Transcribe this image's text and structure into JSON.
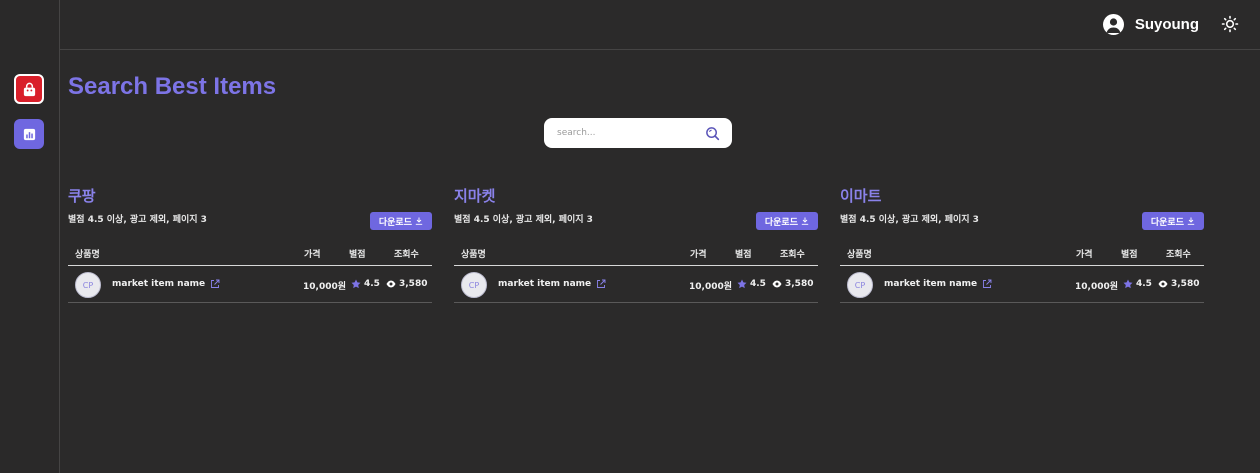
{
  "user": {
    "name": "Suyoung"
  },
  "page": {
    "title": "Search Best Items"
  },
  "search": {
    "placeholder": "search..."
  },
  "table_headers": {
    "product": "상품명",
    "price": "가격",
    "rating": "별점",
    "views": "조회수"
  },
  "panels": [
    {
      "title": "쿠팡",
      "subtitle": "별점 4.5 이상, 광고 제외, 페이지 3",
      "download_label": "다운로드",
      "rows": [
        {
          "avatar": "CP",
          "name": "market item name",
          "price": "10,000원",
          "rating": "4.5",
          "views": "3,580"
        }
      ]
    },
    {
      "title": "지마켓",
      "subtitle": "별점 4.5 이상, 광고 제외, 페이지 3",
      "download_label": "다운로드",
      "rows": [
        {
          "avatar": "CP",
          "name": "market item name",
          "price": "10,000원",
          "rating": "4.5",
          "views": "3,580"
        }
      ]
    },
    {
      "title": "이마트",
      "subtitle": "별점 4.5 이상, 광고 제외, 페이지 3",
      "download_label": "다운로드",
      "rows": [
        {
          "avatar": "CP",
          "name": "market item name",
          "price": "10,000원",
          "rating": "4.5",
          "views": "3,580"
        }
      ]
    }
  ],
  "icons": {
    "sidebar": [
      "shopping-bag-icon",
      "bar-chart-icon"
    ],
    "header": [
      "user-avatar-icon",
      "sun-icon"
    ],
    "search": "search-icon",
    "row": [
      "external-link-icon",
      "star-icon",
      "eye-icon"
    ],
    "download": "download-icon"
  },
  "colors": {
    "accent": "#6f67e0",
    "title": "#7d74e6",
    "shop_red": "#d91f2a",
    "background": "#2b2a2a"
  }
}
